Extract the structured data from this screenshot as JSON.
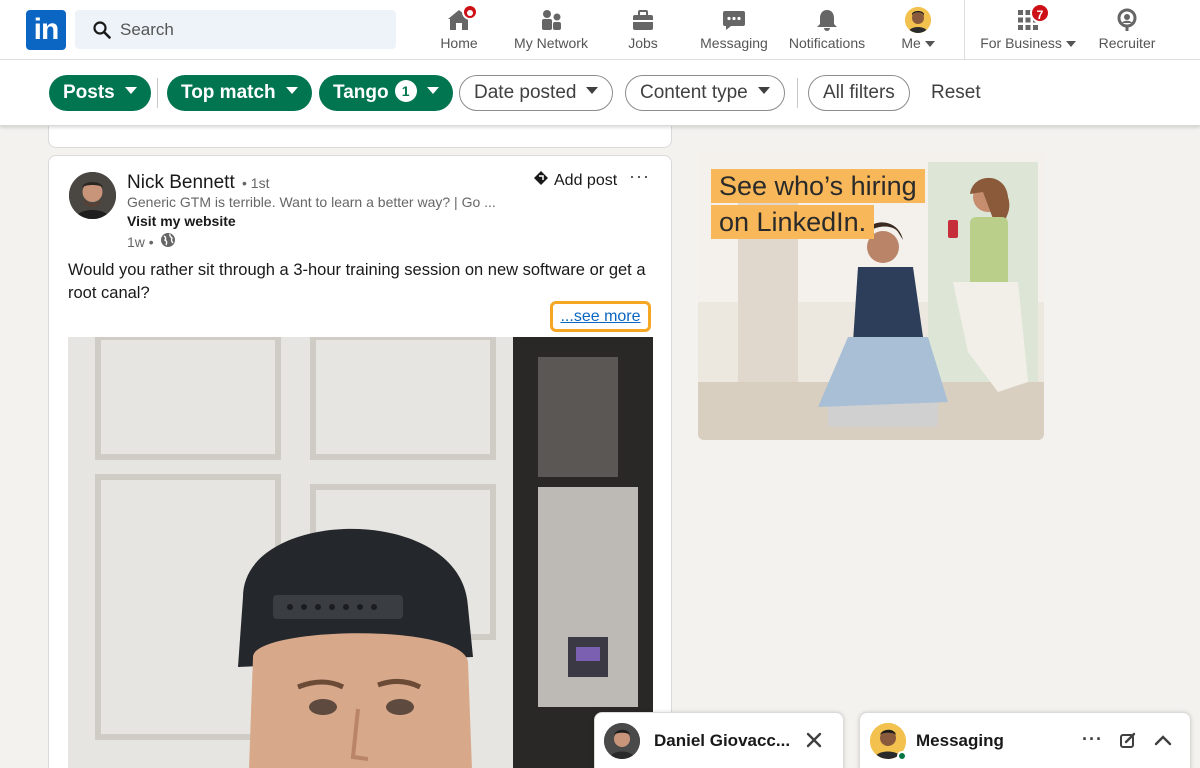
{
  "nav": {
    "logo": "in",
    "search_placeholder": "Search",
    "items": [
      {
        "label": "Home",
        "icon": "home-icon"
      },
      {
        "label": "My Network",
        "icon": "network-icon"
      },
      {
        "label": "Jobs",
        "icon": "briefcase-icon"
      },
      {
        "label": "Messaging",
        "icon": "messaging-icon"
      },
      {
        "label": "Notifications",
        "icon": "bell-icon"
      },
      {
        "label": "Me",
        "icon": "avatar"
      },
      {
        "label": "For Business",
        "icon": "grid-icon"
      },
      {
        "label": "Recruiter",
        "icon": "recruiter-icon"
      }
    ],
    "business_badge": "7"
  },
  "filters": {
    "posts": "Posts",
    "top_match": "Top match",
    "tango": "Tango",
    "tango_count": "1",
    "date_posted": "Date posted",
    "content_type": "Content type",
    "all_filters": "All filters",
    "reset": "Reset"
  },
  "post": {
    "author": "Nick Bennett",
    "degree": "• 1st",
    "headline": "Generic GTM is terrible. Want to learn a better way? | Go ...",
    "website": "Visit my website",
    "time": "1w •",
    "add_post": "Add post",
    "more": "···",
    "text": "Would you rather sit through a 3-hour training session on new software or get a root canal?",
    "see_more": "...see more"
  },
  "ad": {
    "line1": "See who’s hiring",
    "line2": "on LinkedIn."
  },
  "chat": {
    "contact_name": "Daniel Giovacc...",
    "messaging_label": "Messaging"
  },
  "colors": {
    "linkedin_blue": "#0a66c2",
    "filter_green": "#01754f",
    "badge_red": "#cc1016",
    "highlight_orange": "#f5a623",
    "ad_orange": "#f8b85a"
  }
}
